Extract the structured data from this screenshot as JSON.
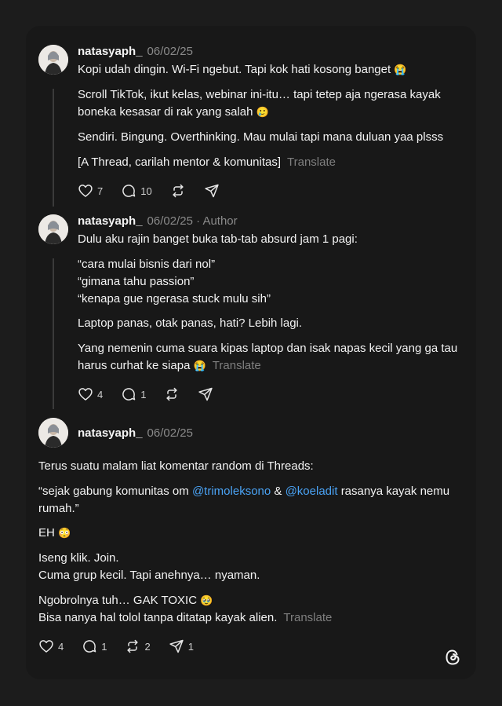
{
  "posts": [
    {
      "username": "natasyaph_",
      "date": "06/02/25",
      "paragraphs": [
        "Kopi udah dingin. Wi-Fi ngebut. Tapi kok hati kosong banget",
        "Scroll TikTok, ikut kelas, webinar ini-itu… tapi tetep aja ngerasa kayak boneka kesasar di rak yang salah",
        "Sendiri. Bingung. Overthinking. Mau mulai tapi mana duluan yaa plsss",
        "[A Thread, carilah mentor & komunitas]"
      ],
      "emojis": [
        "😭",
        "🥲"
      ],
      "translate": "Translate",
      "stats": {
        "likes": "7",
        "replies": "10"
      }
    },
    {
      "username": "natasyaph_",
      "date": "06/02/25",
      "author_label": "· Author",
      "paragraphs": [
        "Dulu aku rajin banget buka tab-tab absurd jam 1 pagi:",
        "“cara mulai bisnis dari nol”\n“gimana tahu passion”\n“kenapa gue ngerasa stuck mulu sih”",
        "Laptop panas, otak panas, hati? Lebih lagi.",
        "Yang nemenin cuma suara kipas laptop dan isak napas kecil yang ga tau harus curhat ke siapa"
      ],
      "emojis": [
        "😭"
      ],
      "translate": "Translate",
      "stats": {
        "likes": "4",
        "replies": "1"
      }
    },
    {
      "username": "natasyaph_",
      "date": "06/02/25",
      "paragraphs": [
        "Terus suatu malam liat komentar random di Threads:",
        "“sejak gabung komunitas om",
        "rasanya kayak nemu rumah.”",
        "EH",
        "Iseng klik. Join.\nCuma grup kecil. Tapi anehnya… nyaman.",
        "Ngobrolnya tuh… GAK TOXIC",
        "Bisa nanya hal tolol tanpa ditatap kayak alien."
      ],
      "mentions": [
        "@trimoleksono",
        "@koeladit"
      ],
      "conjunction": "&",
      "emojis": [
        "😳",
        "🥹"
      ],
      "translate": "Translate",
      "stats": {
        "likes": "4",
        "replies": "1",
        "reposts": "2",
        "shares": "1"
      }
    }
  ],
  "colors": {
    "background": "#1c1c1c",
    "card": "#181818",
    "mention": "#4aa3f5",
    "muted": "#8a8a8a"
  },
  "icons": [
    "heart-icon",
    "comment-icon",
    "repost-icon",
    "share-icon",
    "threads-logo-icon"
  ]
}
